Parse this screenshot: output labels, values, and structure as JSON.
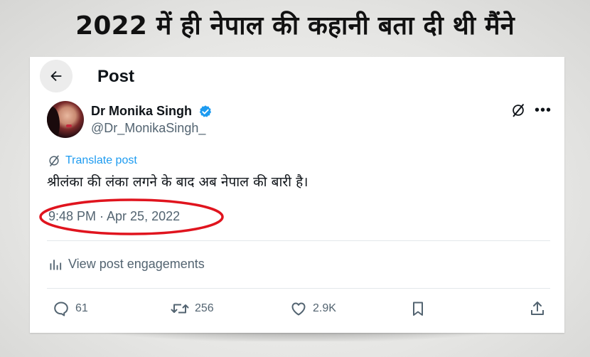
{
  "headline": "2022 में ही नेपाल की कहानी बता दी थी मैंने",
  "header": {
    "title": "Post",
    "back_icon": "arrow-left-icon"
  },
  "author": {
    "name": "Dr Monika Singh",
    "handle": "@Dr_MonikaSingh_",
    "verified": true,
    "verified_color": "#1d9bf0"
  },
  "post": {
    "translate_label": "Translate post",
    "text": "श्रीलंका की लंका लगने के बाद अब नेपाल की बारी है।",
    "timestamp": "9:48 PM · Apr 25, 2022",
    "highlight_color": "#e0141e"
  },
  "engagements_label": "View post engagements",
  "actions": {
    "replies": "61",
    "reposts": "256",
    "likes": "2.9K"
  }
}
